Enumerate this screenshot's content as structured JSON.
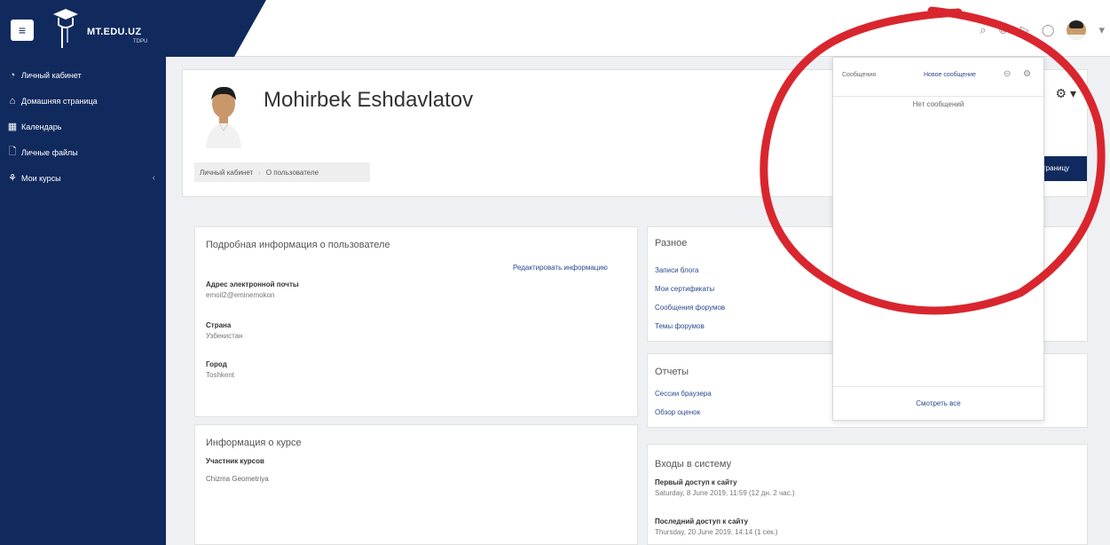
{
  "brand": {
    "name": "MT.EDU.UZ",
    "sub": "TDPU",
    "colors": {
      "navy": "#102a5e",
      "annotation": "#d9262e"
    }
  },
  "topbar": {
    "icons": [
      "search-icon",
      "globe-icon",
      "messages-icon",
      "bell-icon",
      "user-avatar",
      "chevron-down-icon"
    ],
    "caret": "▾"
  },
  "sidebar": {
    "items": [
      {
        "label": "Личный кабинет",
        "icon": "dashboard-icon"
      },
      {
        "label": "Домашняя страница",
        "icon": "home-icon"
      },
      {
        "label": "Календарь",
        "icon": "calendar-icon"
      },
      {
        "label": "Личные файлы",
        "icon": "files-icon"
      },
      {
        "label": "Мои курсы",
        "icon": "courses-icon"
      }
    ]
  },
  "profile": {
    "name": "Mohirbek Eshdavlatov",
    "breadcrumb": [
      "Личный кабинет",
      "О пользователе"
    ],
    "page_button": "страницу"
  },
  "details": {
    "title": "Подробная информация о пользователе",
    "edit_link": "Редактировать информацию",
    "email_label": "Адрес электронной почты",
    "email_value": "emoil2@eminemokon",
    "country_label": "Страна",
    "country_value": "Узбекистан",
    "city_label": "Город",
    "city_value": "Toshkent"
  },
  "course": {
    "title": "Информация о курсе",
    "label": "Участник курсов",
    "value": "Chizma Geometriya"
  },
  "misc": {
    "title": "Разное",
    "links": [
      "Записи блога",
      "Мои сертификаты",
      "Сообщения форумов",
      "Темы форумов"
    ]
  },
  "reports": {
    "title": "Отчеты",
    "links": [
      "Сессии браузера",
      "Обзор оценок"
    ]
  },
  "logins": {
    "title": "Входы в систему",
    "first_label": "Первый доступ к сайту",
    "first_value": "Saturday, 8 June 2019, 11:59  (12 дн. 2 час.)",
    "last_label": "Последний доступ к сайту",
    "last_value": "Thursday, 20 June 2019, 14:14  (1 сек.)"
  },
  "messages": {
    "title": "Сообщения",
    "new_message": "Новое сообщение",
    "empty": "Нет сообщений",
    "view_all": "Смотреть все"
  }
}
